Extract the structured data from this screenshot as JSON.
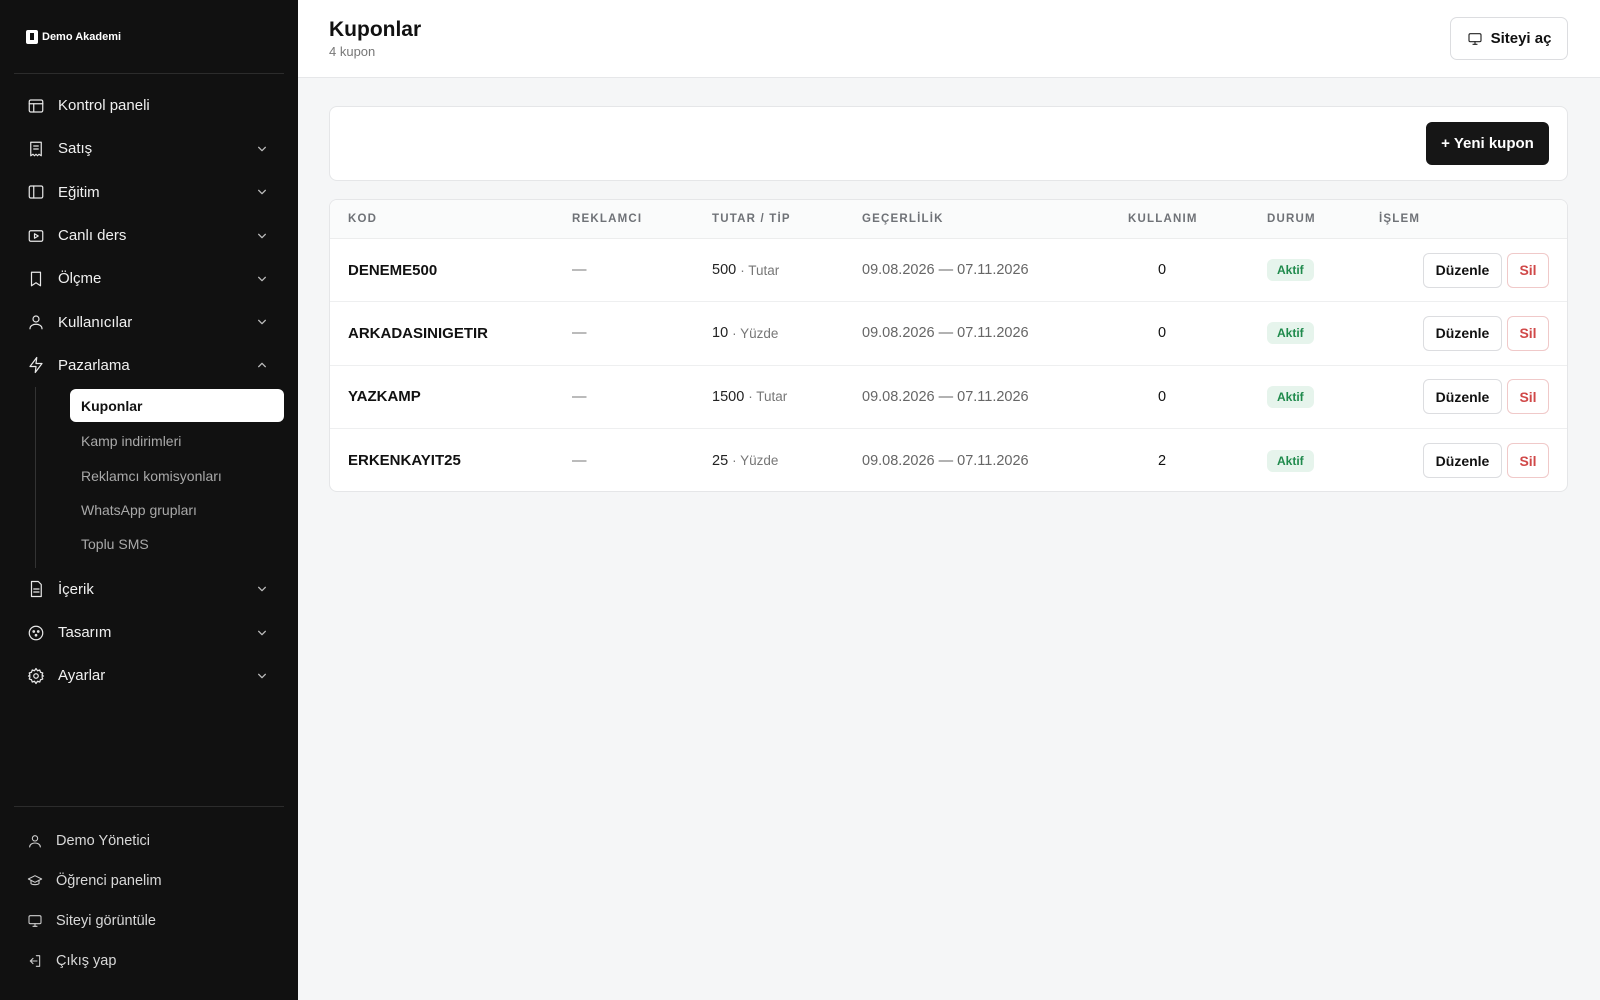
{
  "brand": {
    "name": "Demo Akademi"
  },
  "sidebar": {
    "items": [
      {
        "label": "Kontrol paneli",
        "icon": "layout-icon",
        "expandable": false
      },
      {
        "label": "Satış",
        "icon": "receipt-icon",
        "expandable": true
      },
      {
        "label": "Eğitim",
        "icon": "book-icon",
        "expandable": true
      },
      {
        "label": "Canlı ders",
        "icon": "video-icon",
        "expandable": true
      },
      {
        "label": "Ölçme",
        "icon": "bookmark-icon",
        "expandable": true
      },
      {
        "label": "Kullanıcılar",
        "icon": "user-icon",
        "expandable": true
      },
      {
        "label": "Pazarlama",
        "icon": "lightning-icon",
        "expandable": true,
        "expanded": true
      },
      {
        "label": "İçerik",
        "icon": "file-icon",
        "expandable": true
      },
      {
        "label": "Tasarım",
        "icon": "palette-icon",
        "expandable": true
      },
      {
        "label": "Ayarlar",
        "icon": "gear-icon",
        "expandable": true
      }
    ],
    "submenu": [
      {
        "label": "Kuponlar",
        "active": true
      },
      {
        "label": "Kamp indirimleri"
      },
      {
        "label": "Reklamcı komisyonları"
      },
      {
        "label": "WhatsApp grupları"
      },
      {
        "label": "Toplu SMS"
      }
    ],
    "bottom": [
      {
        "label": "Demo Yönetici",
        "icon": "user-icon"
      },
      {
        "label": "Öğrenci panelim",
        "icon": "graduation-cap-icon"
      },
      {
        "label": "Siteyi görüntüle",
        "icon": "monitor-icon"
      },
      {
        "label": "Çıkış yap",
        "icon": "logout-icon"
      }
    ]
  },
  "header": {
    "title": "Kuponlar",
    "subtitle": "4 kupon",
    "site_button": "Siteyi aç"
  },
  "toolbar": {
    "new_button": "+ Yeni kupon"
  },
  "table": {
    "columns": {
      "kod": "KOD",
      "reklamci": "REKLAMCI",
      "tutar": "TUTAR / TİP",
      "gecerlilik": "GEÇERLİLİK",
      "kullanim": "KULLANIM",
      "durum": "DURUM",
      "islem": "İŞLEM"
    },
    "edit_label": "Düzenle",
    "delete_label": "Sil",
    "rows": [
      {
        "kod": "DENEME500",
        "reklamci": "—",
        "tutar": "500",
        "tip": "· Tutar",
        "gecerlilik": "09.08.2026 — 07.11.2026",
        "kullanim": "0",
        "durum": "Aktif"
      },
      {
        "kod": "ARKADASINIGETIR",
        "reklamci": "—",
        "tutar": "10",
        "tip": "· Yüzde",
        "gecerlilik": "09.08.2026 — 07.11.2026",
        "kullanim": "0",
        "durum": "Aktif"
      },
      {
        "kod": "YAZKAMP",
        "reklamci": "—",
        "tutar": "1500",
        "tip": "· Tutar",
        "gecerlilik": "09.08.2026 — 07.11.2026",
        "kullanim": "0",
        "durum": "Aktif"
      },
      {
        "kod": "ERKENKAYIT25",
        "reklamci": "—",
        "tutar": "25",
        "tip": "· Yüzde",
        "gecerlilik": "09.08.2026 — 07.11.2026",
        "kullanim": "2",
        "durum": "Aktif"
      }
    ]
  },
  "colors": {
    "sidebar_bg": "#111111",
    "accent": "#161616",
    "status_active_bg": "#e6f4ec",
    "status_active_fg": "#1f8a4c",
    "danger": "#d04848"
  }
}
